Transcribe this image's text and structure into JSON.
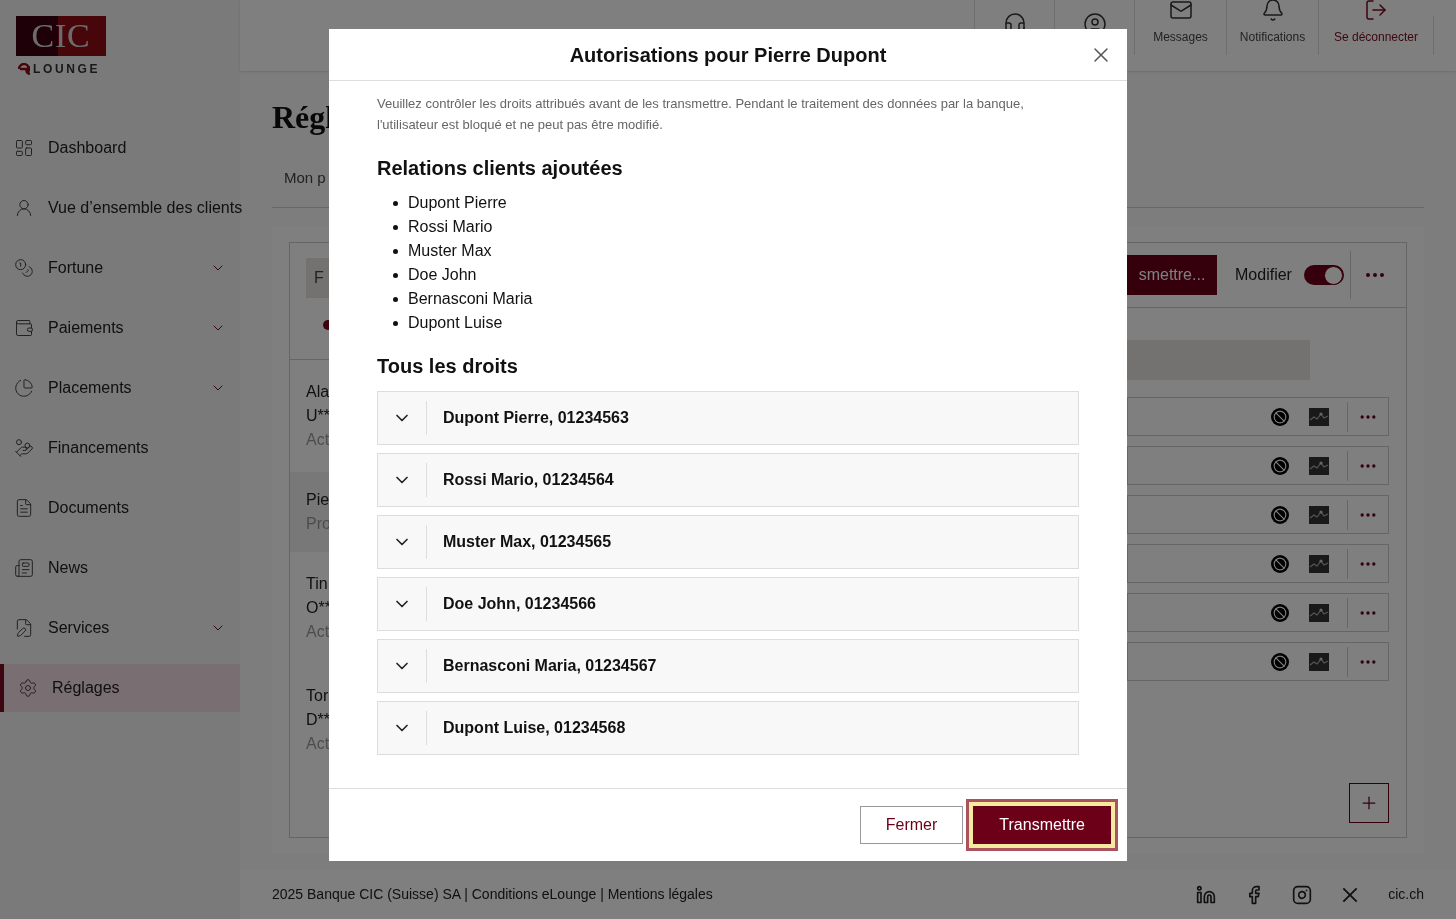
{
  "sidebar": {
    "logo": {
      "letters": "CIC",
      "sub": "LOUNGE"
    },
    "items": [
      {
        "label": "Dashboard",
        "expandable": false,
        "selected": false
      },
      {
        "label": "Vue d’ensemble des clients",
        "expandable": false,
        "selected": false
      },
      {
        "label": "Fortune",
        "expandable": true,
        "selected": false
      },
      {
        "label": "Paiements",
        "expandable": true,
        "selected": false
      },
      {
        "label": "Placements",
        "expandable": true,
        "selected": false
      },
      {
        "label": "Financements",
        "expandable": false,
        "selected": false
      },
      {
        "label": "Documents",
        "expandable": false,
        "selected": false
      },
      {
        "label": "News",
        "expandable": false,
        "selected": false
      },
      {
        "label": "Services",
        "expandable": true,
        "selected": false
      },
      {
        "label": "Réglages",
        "expandable": false,
        "selected": true
      }
    ]
  },
  "header": {
    "icon_buttons": [
      {
        "kind": "headset"
      },
      {
        "kind": "user"
      }
    ],
    "actions": [
      {
        "label": "Messages",
        "kind": "mail"
      },
      {
        "label": "Notifications",
        "kind": "bell"
      },
      {
        "label": "Se déconnecter",
        "kind": "logout"
      }
    ]
  },
  "page": {
    "title": "Régl",
    "tab": "Mon p",
    "filter_button": "F",
    "users": [
      {
        "name": "Ala",
        "code": "U**",
        "status": "Act",
        "selected": false
      },
      {
        "name": "Pie",
        "status": "Pro",
        "selected": true
      },
      {
        "name": "Tin",
        "code": "O**",
        "status": "Act",
        "selected": false
      },
      {
        "name": "Tor",
        "code": "D**",
        "status": "Act",
        "selected": false
      }
    ],
    "transmit_button": "smettre...",
    "toggle": {
      "label": "Modifier",
      "on": true
    },
    "right_rows": [
      {
        "kind": "right"
      },
      {
        "kind": "right"
      },
      {
        "kind": "right"
      },
      {
        "kind": "right"
      },
      {
        "kind": "right"
      },
      {
        "kind": "right"
      }
    ]
  },
  "modal": {
    "title": "Autorisations pour Pierre Dupont",
    "intro": "Veuillez contrôler les droits attribués avant de les transmettre. Pendant le traitement des données par la banque, l'utilisateur est bloqué et ne peut pas être modifié.",
    "clients_heading": "Relations clients ajoutées",
    "clients": [
      "Dupont Pierre",
      "Rossi Mario",
      "Muster Max",
      "Doe John",
      "Bernasconi Maria",
      "Dupont Luise"
    ],
    "rights_heading": "Tous les droits",
    "rights": [
      {
        "label": "Dupont Pierre, 01234563",
        "expanded": false
      },
      {
        "label": "Rossi Mario, 01234564",
        "expanded": false
      },
      {
        "label": "Muster Max, 01234565",
        "expanded": false
      },
      {
        "label": "Doe John, 01234566",
        "expanded": false
      },
      {
        "label": "Bernasconi Maria, 01234567",
        "expanded": false
      },
      {
        "label": "Dupont Luise, 01234568",
        "expanded": false
      }
    ],
    "buttons": [
      {
        "label": "Fermer",
        "kind": "secondary",
        "focused": false
      },
      {
        "label": "Transmettre",
        "kind": "primary",
        "focused": true
      }
    ]
  },
  "footer": {
    "text": "2025 Banque CIC (Suisse) SA | Conditions eLounge | Mentions légales",
    "socials": [
      {
        "kind": "linkedin"
      },
      {
        "kind": "facebook"
      },
      {
        "kind": "instagram"
      },
      {
        "kind": "x"
      }
    ],
    "link": "cic.ch"
  }
}
